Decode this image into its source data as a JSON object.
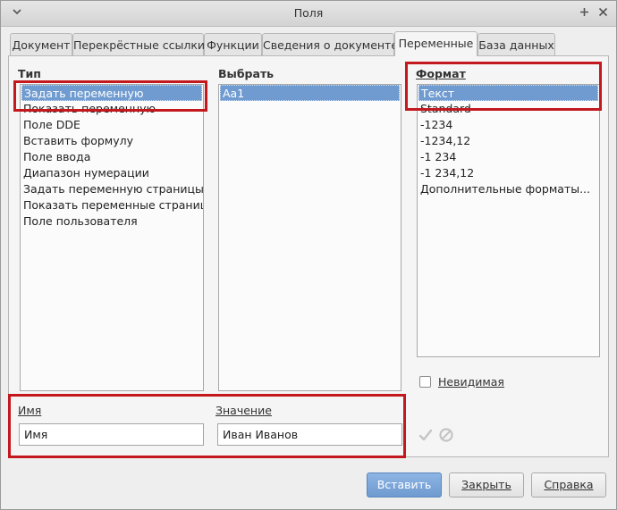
{
  "window": {
    "title": "Поля"
  },
  "tabs": [
    {
      "label": "Документ"
    },
    {
      "label": "Перекрёстные ссылки"
    },
    {
      "label": "Функции"
    },
    {
      "label": "Сведения о документе"
    },
    {
      "label": "Переменные"
    },
    {
      "label": "База данных"
    }
  ],
  "type": {
    "label": "Тип",
    "items": [
      "Задать переменную",
      "Показать переменную",
      "Поле DDE",
      "Вставить формулу",
      "Поле ввода",
      "Диапазон нумерации",
      "Задать переменную страницы",
      "Показать переменные страницы",
      "Поле пользователя"
    ],
    "selected_index": 0
  },
  "select": {
    "label": "Выбрать",
    "items": [
      "Aa1"
    ],
    "selected_index": 0
  },
  "format": {
    "label": "Формат",
    "items": [
      "Текст",
      "Standard",
      "-1234",
      "-1234,12",
      "-1 234",
      "-1 234,12",
      "Дополнительные форматы..."
    ],
    "selected_index": 0
  },
  "invisible": {
    "label": "Невидимая",
    "checked": false
  },
  "name": {
    "label": "Имя",
    "value": "Имя"
  },
  "value": {
    "label": "Значение",
    "value": "Иван Иванов"
  },
  "buttons": {
    "insert": "Вставить",
    "close": "Закрыть",
    "help": "Справка"
  },
  "colors": {
    "selection": "#6f9bd0",
    "highlight_box": "#c3191e"
  }
}
